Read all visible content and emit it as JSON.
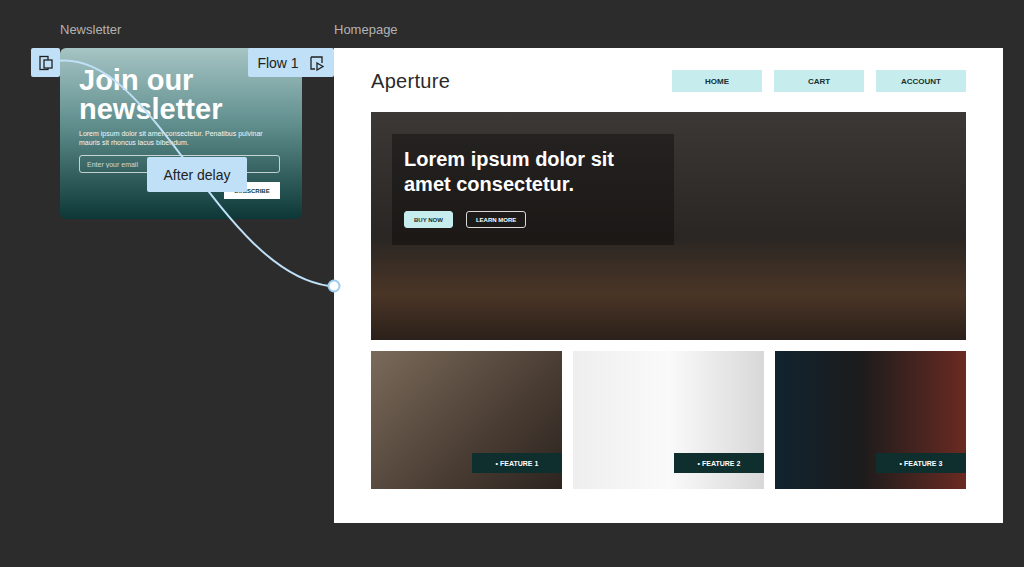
{
  "canvas_frames": [
    {
      "label": "Newsletter"
    },
    {
      "label": "Homepage"
    }
  ],
  "flow": {
    "name": "Flow 1",
    "trigger": "After delay"
  },
  "newsletter": {
    "title": "Join our newsletter",
    "body": "Lorem ipsum dolor sit amet consectetur. Penatibus pulvinar mauris sit rhoncus lacus bibendum.",
    "email_placeholder": "Enter your email",
    "button": "SUBSCRIBE"
  },
  "homepage": {
    "logo": "Aperture",
    "nav": [
      {
        "label": "HOME"
      },
      {
        "label": "CART"
      },
      {
        "label": "ACCOUNT"
      }
    ],
    "hero": {
      "title": "Lorem ipsum dolor sit amet consectetur.",
      "buttons": [
        {
          "label": "BUY NOW",
          "kind": "primary"
        },
        {
          "label": "LEARN MORE",
          "kind": "outline"
        }
      ]
    },
    "features": [
      {
        "label": "• FEATURE 1"
      },
      {
        "label": "• FEATURE 2"
      },
      {
        "label": "• FEATURE 3"
      }
    ]
  }
}
